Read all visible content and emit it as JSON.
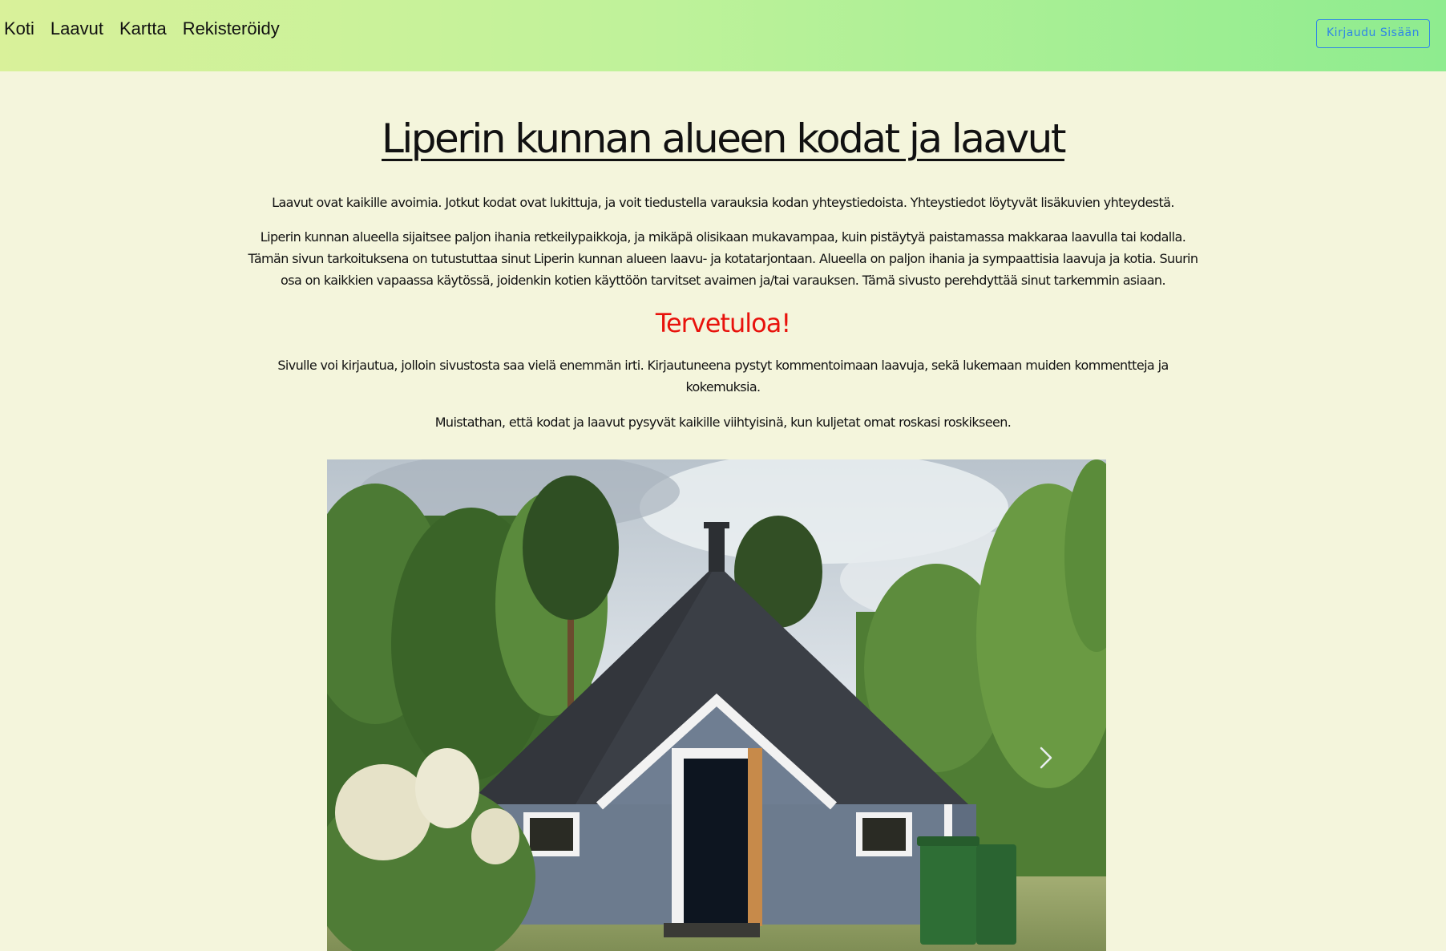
{
  "nav": {
    "links": [
      "Koti",
      "Laavut",
      "Kartta",
      "Rekisteröidy"
    ],
    "login_label": "Kirjaudu Sisään"
  },
  "main": {
    "title": "Liperin kunnan alueen kodat ja laavut",
    "intro": "Laavut ovat kaikille avoimia. Jotkut kodat ovat lukittuja, ja voit tiedustella varauksia kodan yhteystiedoista. Yhteystiedot löytyvät lisäkuvien yhteydestä.",
    "description": "Liperin kunnan alueella sijaitsee paljon ihania retkeilypaikkoja, ja mikäpä olisikaan mukavampaa, kuin pistäytyä paistamassa makkaraa laavulla tai kodalla. Tämän sivun tarkoituksena on tutustuttaa sinut Liperin kunnan alueen laavu- ja kotatarjontaan. Alueella on paljon ihania ja sympaattisia laavuja ja kotia. Suurin osa on kaikkien vapaassa käytössä, joidenkin kotien käyttöön tarvitset avaimen ja/tai varauksen. Tämä sivusto perehdyttää sinut tarkemmin asiaan.",
    "welcome": "Tervetuloa!",
    "login_info": "Sivulle voi kirjautua, jolloin sivustosta saa vielä enemmän irti. Kirjautuneena pystyt kommentoimaan laavuja, sekä lukemaan muiden kommentteja ja kokemuksia.",
    "reminder": "Muistathan, että kodat ja laavut pysyvät kaikille viihtyisinä, kun kuljetat omat roskasi roskikseen."
  },
  "carousel": {
    "icons": {
      "next": "chevron-right-icon"
    }
  }
}
